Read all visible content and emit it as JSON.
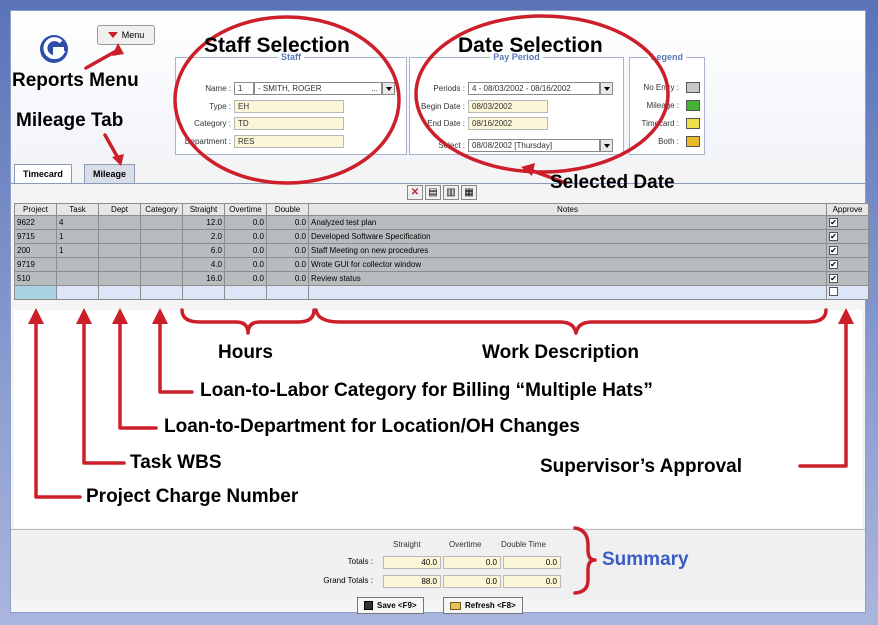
{
  "menu": {
    "label": "Menu"
  },
  "staff": {
    "title": "Staff",
    "labels": {
      "name": "Name :",
      "type": "Type :",
      "category": "Category :",
      "department": "Department :"
    },
    "name_num": "1",
    "name_value": "- SMITH, ROGER",
    "name_more": "...",
    "type": "EH",
    "category": "TD",
    "department": "RES"
  },
  "pay_period": {
    "title": "Pay Period",
    "labels": {
      "periods": "Periods :",
      "begin": "Begin Date :",
      "end": "End Date :",
      "select": "Select :"
    },
    "periods": "4 - 08/03/2002 - 08/16/2002",
    "begin_date": "08/03/2002",
    "end_date": "08/16/2002",
    "select": "08/08/2002 [Thursday]"
  },
  "legend": {
    "title": "Legend",
    "items": [
      {
        "label": "No Entry :",
        "color": "#c8c8c8"
      },
      {
        "label": "Mileage :",
        "color": "#44b233"
      },
      {
        "label": "Timecard :",
        "color": "#f0e04a"
      },
      {
        "label": "Both :",
        "color": "#e9b92a"
      }
    ]
  },
  "tabs": [
    {
      "label": "Timecard"
    },
    {
      "label": "Mileage"
    }
  ],
  "toolbar_icons": [
    "delete-row-icon",
    "insert-row-icon",
    "copy-row-icon",
    "calendar-icon"
  ],
  "grid": {
    "columns": [
      "Project",
      "Task",
      "Dept",
      "Category",
      "Straight",
      "Overtime",
      "Double",
      "Notes",
      "Approve"
    ],
    "rows": [
      {
        "project": "9622",
        "task": "4",
        "dept": "",
        "category": "",
        "straight": "12.0",
        "overtime": "0.0",
        "double": "0.0",
        "notes": "Analyzed test plan",
        "approve": true
      },
      {
        "project": "9715",
        "task": "1",
        "dept": "",
        "category": "",
        "straight": "2.0",
        "overtime": "0.0",
        "double": "0.0",
        "notes": "Developed Software Specification",
        "approve": true
      },
      {
        "project": "200",
        "task": "1",
        "dept": "",
        "category": "",
        "straight": "6.0",
        "overtime": "0.0",
        "double": "0.0",
        "notes": "Staff Meeting on new procedures",
        "approve": true
      },
      {
        "project": "9719",
        "task": "",
        "dept": "",
        "category": "",
        "straight": "4.0",
        "overtime": "0.0",
        "double": "0.0",
        "notes": "Wrote GUI for collector window",
        "approve": true
      },
      {
        "project": "510",
        "task": "",
        "dept": "",
        "category": "",
        "straight": "16.0",
        "overtime": "0.0",
        "double": "0.0",
        "notes": "Review status",
        "approve": true
      }
    ]
  },
  "summary": {
    "headers": [
      "Straight",
      "Overtime",
      "Double Time"
    ],
    "totals_label": "Totals :",
    "grand_totals_label": "Grand Totals :",
    "totals": [
      "40.0",
      "0.0",
      "0.0"
    ],
    "grand_totals": [
      "88.0",
      "0.0",
      "0.0"
    ]
  },
  "buttons": {
    "save": "Save <F9>",
    "refresh": "Refresh <F8>"
  },
  "annotations": {
    "staff_selection": "Staff Selection",
    "date_selection": "Date Selection",
    "reports_menu": "Reports Menu",
    "mileage_tab": "Mileage Tab",
    "selected_date": "Selected Date",
    "hours": "Hours",
    "work_description": "Work Description",
    "loan_labor": "Loan-to-Labor Category for Billing “Multiple Hats”",
    "loan_dept": "Loan-to-Department for Location/OH Changes",
    "task_wbs": "Task WBS",
    "supervisor": "Supervisor’s Approval",
    "project_charge": "Project Charge Number",
    "summary": "Summary"
  },
  "colors": {
    "annotation_red": "#cc1f2a",
    "summary_blue": "#3a5cc4",
    "row_gray": "#b9bcbf",
    "field_yellow": "#fbf6d8"
  }
}
